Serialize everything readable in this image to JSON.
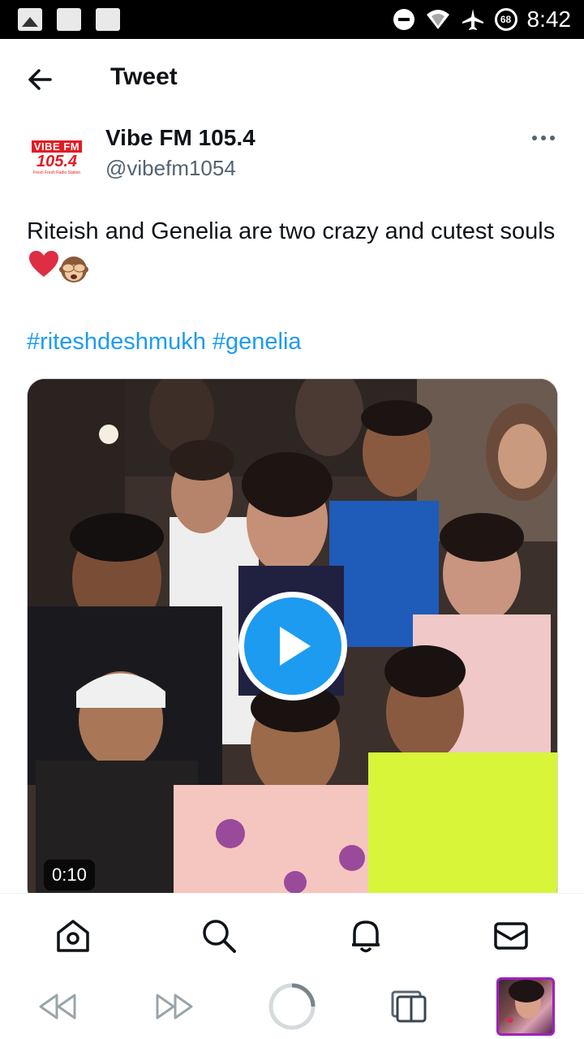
{
  "status_bar": {
    "time": "8:42",
    "battery": "68",
    "icons": [
      "image-icon",
      "square-icon",
      "square-icon",
      "do-not-disturb-icon",
      "wifi-icon",
      "airplane-icon",
      "battery-saver-icon"
    ]
  },
  "header": {
    "title": "Tweet",
    "back_icon": "arrow-left-icon"
  },
  "author": {
    "name": "Vibe FM 105.4",
    "handle": "@vibefm1054",
    "avatar_logo_top": "VIBE FM",
    "avatar_logo_number": "105.4",
    "avatar_logo_tagline": "Fresh Fresh Radio Station",
    "more_icon": "more-horizontal-icon"
  },
  "tweet": {
    "text": "Riteish and Genelia are two crazy and cutest souls",
    "emojis": [
      "red-heart",
      "see-no-evil-monkey"
    ],
    "hashtags": [
      "#riteshdeshmukh",
      "#genelia"
    ]
  },
  "media": {
    "type": "video",
    "duration": "0:10",
    "play_icon": "play-icon"
  },
  "tab_bar": {
    "items": [
      {
        "name": "home",
        "icon": "home-icon"
      },
      {
        "name": "search",
        "icon": "search-icon"
      },
      {
        "name": "notifications",
        "icon": "bell-icon"
      },
      {
        "name": "messages",
        "icon": "mail-icon"
      }
    ]
  },
  "system_bar": {
    "items": [
      "rewind-icon",
      "fast-forward-icon",
      "loading-icon",
      "tabs-icon",
      "app-thumbnail"
    ]
  },
  "colors": {
    "accent": "#1d9bf0",
    "text": "#0f1419",
    "secondary_text": "#536471",
    "brand_red": "#e31b23",
    "heart": "#e0245e"
  }
}
